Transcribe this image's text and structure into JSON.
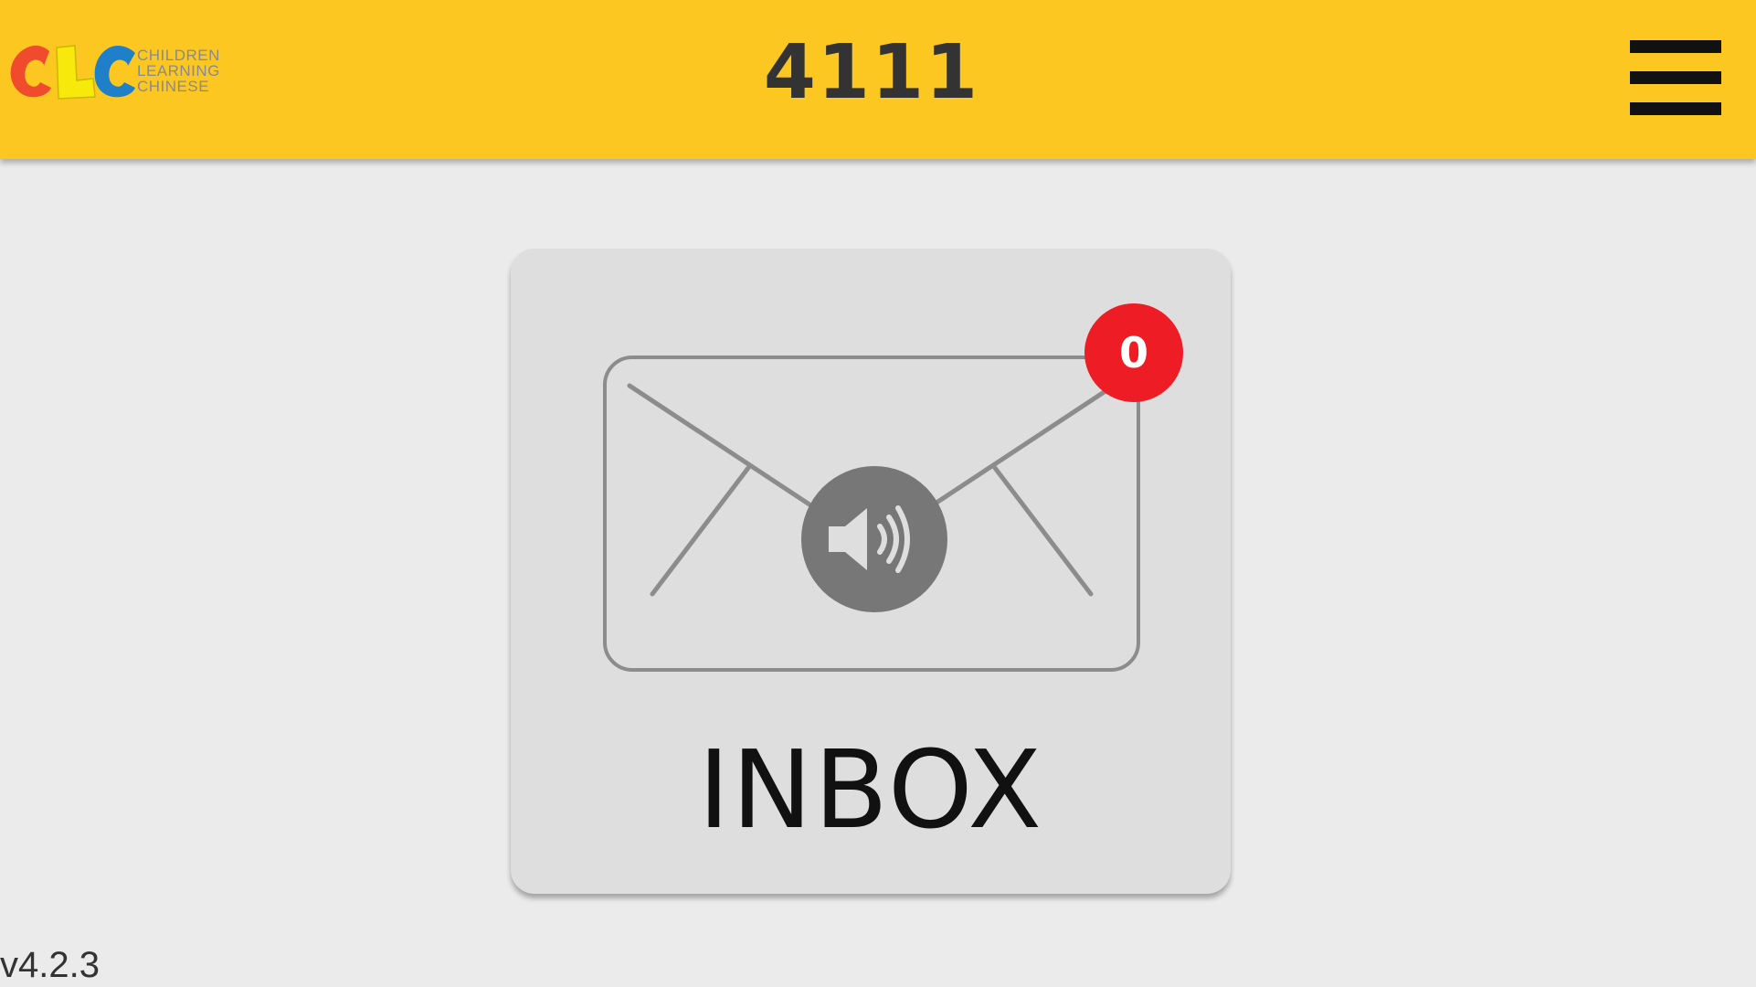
{
  "header": {
    "logo": {
      "letters": "CLC",
      "lines": [
        "CHILDREN",
        "LEARNING",
        "CHINESE"
      ]
    },
    "title": "4111",
    "menu_icon": "hamburger-menu-icon",
    "background_color": "#fdc722"
  },
  "inbox": {
    "label": "INBOX",
    "badge_count": "0",
    "badge_color": "#ee1c24",
    "icons": [
      "envelope-icon",
      "speaker-icon"
    ]
  },
  "footer": {
    "version": "v4.2.3"
  }
}
